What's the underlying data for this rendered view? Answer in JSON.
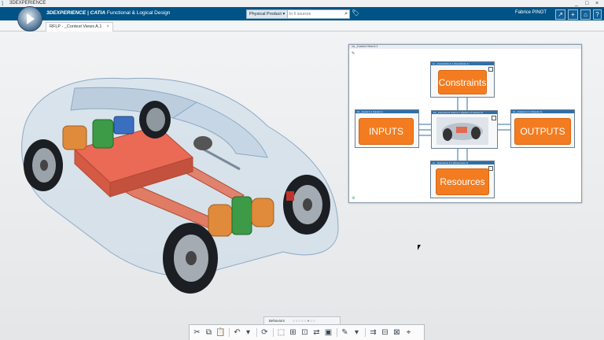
{
  "window": {
    "app_name": "3DEXPERIENCE",
    "controls": [
      "_",
      "□",
      "×"
    ]
  },
  "header": {
    "brand_compass": "3D",
    "brand_app": "3DEXPERIENCE | CATIA",
    "brand_title": "Functional & Logical Design",
    "search_scope": "Physical Product",
    "search_placeholder": "In 6 sources",
    "user_name": "Fabrice PINOT",
    "icons": [
      "search-icon",
      "tag-icon",
      "share-icon",
      "add-icon",
      "expand-icon",
      "home-icon",
      "help-icon"
    ]
  },
  "tabs": [
    {
      "label": "RFLP - _Context Views A.1",
      "close": "×"
    }
  ],
  "panel": {
    "title": "1a _Context View A.1",
    "nodes": {
      "constraints": {
        "header": "1c _Constraints A.1 (Constraints 1)",
        "label": "Constraints"
      },
      "inputs": {
        "header": "1b _Inputs A.1 (Inputs 1)",
        "label": "INPUTS"
      },
      "component": {
        "header": "1a _Component View A.1 (System of interest 1)"
      },
      "outputs": {
        "header": "1d _Outputs A.1 (Outputs 1)",
        "label": "OUTPUTS"
      },
      "resources": {
        "header": "1e _Resources A.1 (Resources 1)",
        "label": "Resources"
      }
    }
  },
  "behaviors": {
    "label": "Behaviors",
    "dots": "○○○○○●○○"
  },
  "toolbar": {
    "icons": [
      "cut-icon",
      "copy-icon",
      "paste-icon",
      "undo-icon",
      "redo-icon",
      "update-icon",
      "select-icon",
      "new-block-icon",
      "new-port-icon",
      "connect-icon",
      "instance-icon",
      "edit-icon",
      "layout-icon",
      "flow-icon",
      "expose-icon"
    ]
  },
  "colors": {
    "brand_blue": "#005386",
    "orange": "#f37c20",
    "node_header": "#2f6fa8"
  }
}
